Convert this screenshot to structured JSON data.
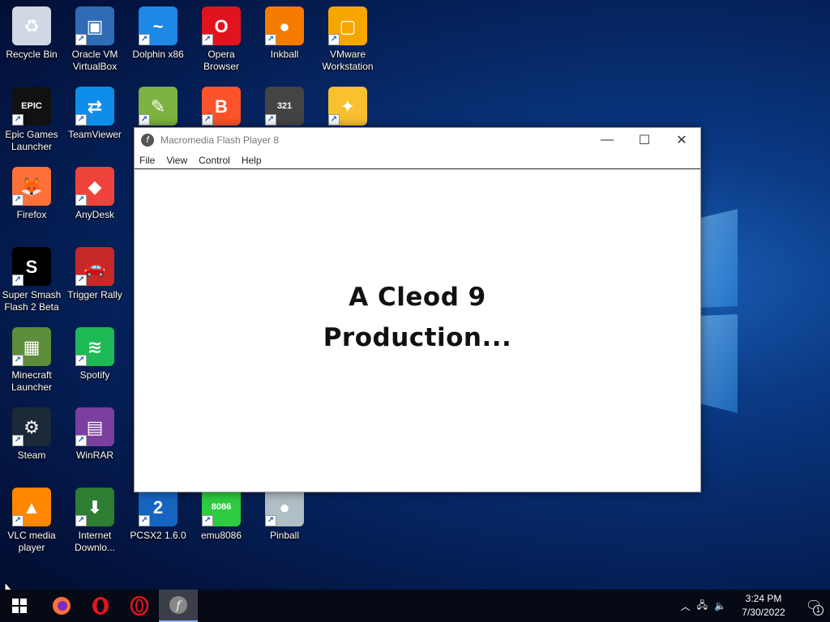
{
  "desktop": {
    "icons": [
      {
        "label": "Recycle Bin",
        "icon": "recycle-bin-icon"
      },
      {
        "label": "Oracle VM VirtualBox",
        "icon": "virtualbox-icon"
      },
      {
        "label": "Dolphin x86",
        "icon": "dolphin-icon"
      },
      {
        "label": "Opera Browser",
        "icon": "opera-icon"
      },
      {
        "label": "Inkball",
        "icon": "inkball-icon"
      },
      {
        "label": "VMware Workstation",
        "icon": "vmware-icon"
      },
      {
        "label": "Epic Games Launcher",
        "icon": "epic-games-icon"
      },
      {
        "label": "TeamViewer",
        "icon": "teamviewer-icon"
      },
      {
        "label": "",
        "icon": "editor-icon"
      },
      {
        "label": "",
        "icon": "brave-icon"
      },
      {
        "label": "",
        "icon": "media-player-classic-icon"
      },
      {
        "label": "",
        "icon": "puzzle-icon"
      },
      {
        "label": "Firefox",
        "icon": "firefox-icon"
      },
      {
        "label": "AnyDesk",
        "icon": "anydesk-icon"
      },
      {
        "label": "Super Smash Flash 2 Beta",
        "icon": "ssf2-icon"
      },
      {
        "label": "Trigger Rally",
        "icon": "trigger-rally-icon"
      },
      {
        "label": "Minecraft Launcher",
        "icon": "minecraft-icon"
      },
      {
        "label": "Spotify",
        "icon": "spotify-icon"
      },
      {
        "label": "Steam",
        "icon": "steam-icon"
      },
      {
        "label": "WinRAR",
        "icon": "winrar-icon"
      },
      {
        "label": "VLC media player",
        "icon": "vlc-icon"
      },
      {
        "label": "Internet Downlo...",
        "icon": "idm-icon"
      },
      {
        "label": "PCSX2 1.6.0",
        "icon": "pcsx2-icon"
      },
      {
        "label": "emu8086",
        "icon": "emu8086-icon"
      },
      {
        "label": "Pinball",
        "icon": "pinball-icon"
      }
    ]
  },
  "window": {
    "title": "Macromedia Flash Player 8",
    "menu": [
      "File",
      "View",
      "Control",
      "Help"
    ],
    "content_line1": "A Cleod 9",
    "content_line2": "Production..."
  },
  "taskbar": {
    "time": "3:24 PM",
    "date": "7/30/2022",
    "notification_count": "1"
  },
  "colors": {
    "opera_red": "#e1141e",
    "firefox_orange": "#ff7139",
    "accent": "#8ab4f8"
  }
}
